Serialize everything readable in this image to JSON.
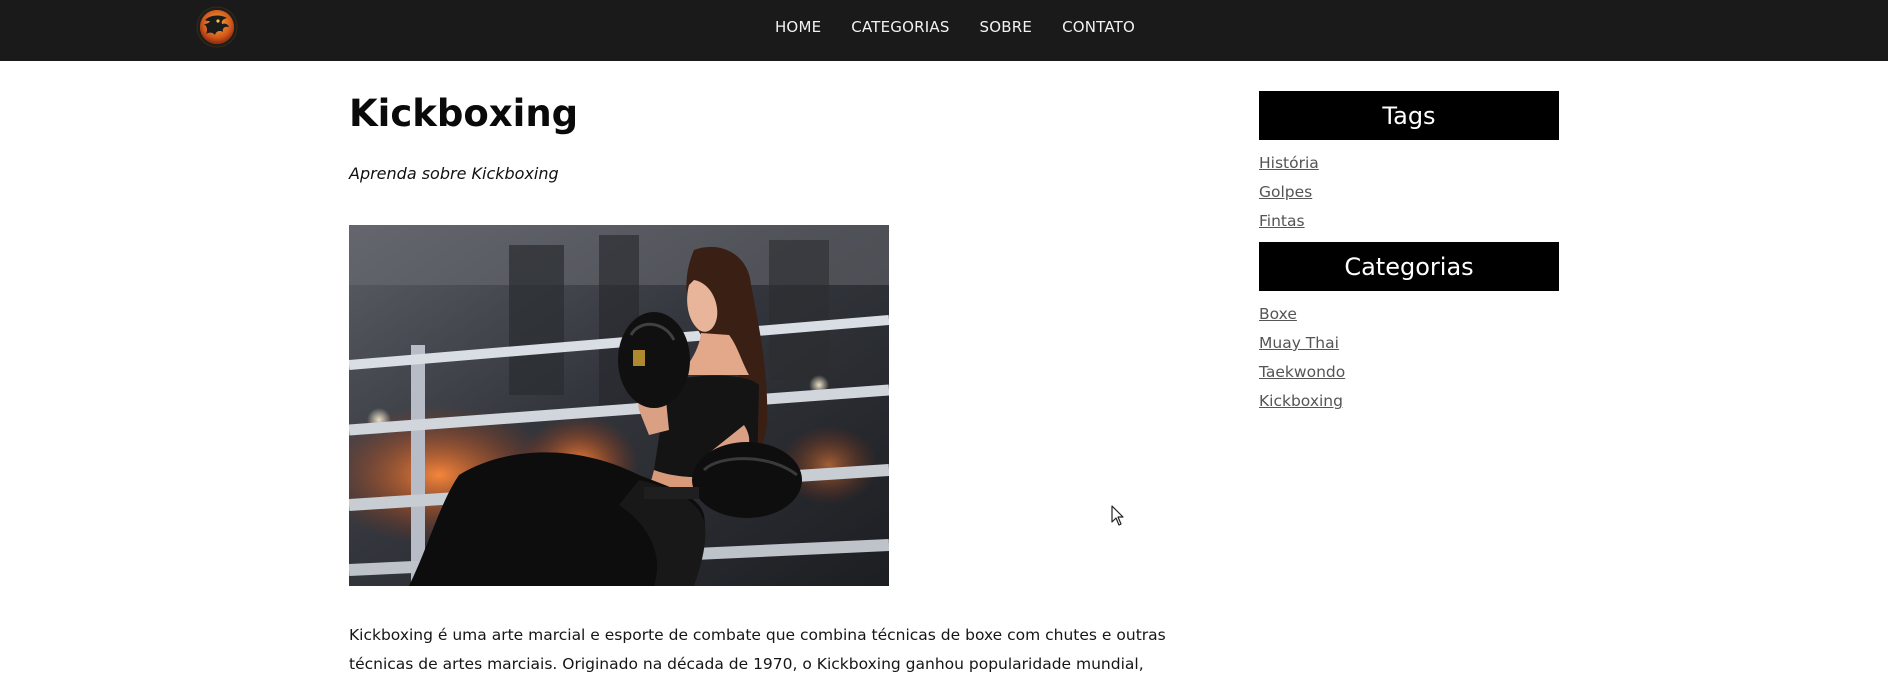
{
  "nav": {
    "logo_alt": "dragon logo",
    "links": [
      {
        "label": "HOME"
      },
      {
        "label": "CATEGORIAS"
      },
      {
        "label": "SOBRE"
      },
      {
        "label": "CONTATO"
      }
    ]
  },
  "article": {
    "title": "Kickboxing",
    "subtitle": "Aprenda sobre Kickboxing",
    "image_icon": "photo-kickboxer-in-ring",
    "body": "Kickboxing é uma arte marcial e esporte de combate que combina técnicas de boxe com chutes e outras técnicas de artes marciais. Originado na década de 1970, o Kickboxing ganhou popularidade mundial,"
  },
  "sidebar": {
    "tags": {
      "title": "Tags",
      "items": [
        {
          "label": "História"
        },
        {
          "label": "Golpes"
        },
        {
          "label": "Fintas"
        }
      ]
    },
    "categories": {
      "title": "Categorias",
      "items": [
        {
          "label": "Boxe"
        },
        {
          "label": "Muay Thai"
        },
        {
          "label": "Taekwondo"
        },
        {
          "label": "Kickboxing"
        }
      ]
    }
  },
  "colors": {
    "navbar_bg": "#1a1a1a",
    "widget_header_bg": "#000000",
    "link_color": "#555555"
  }
}
